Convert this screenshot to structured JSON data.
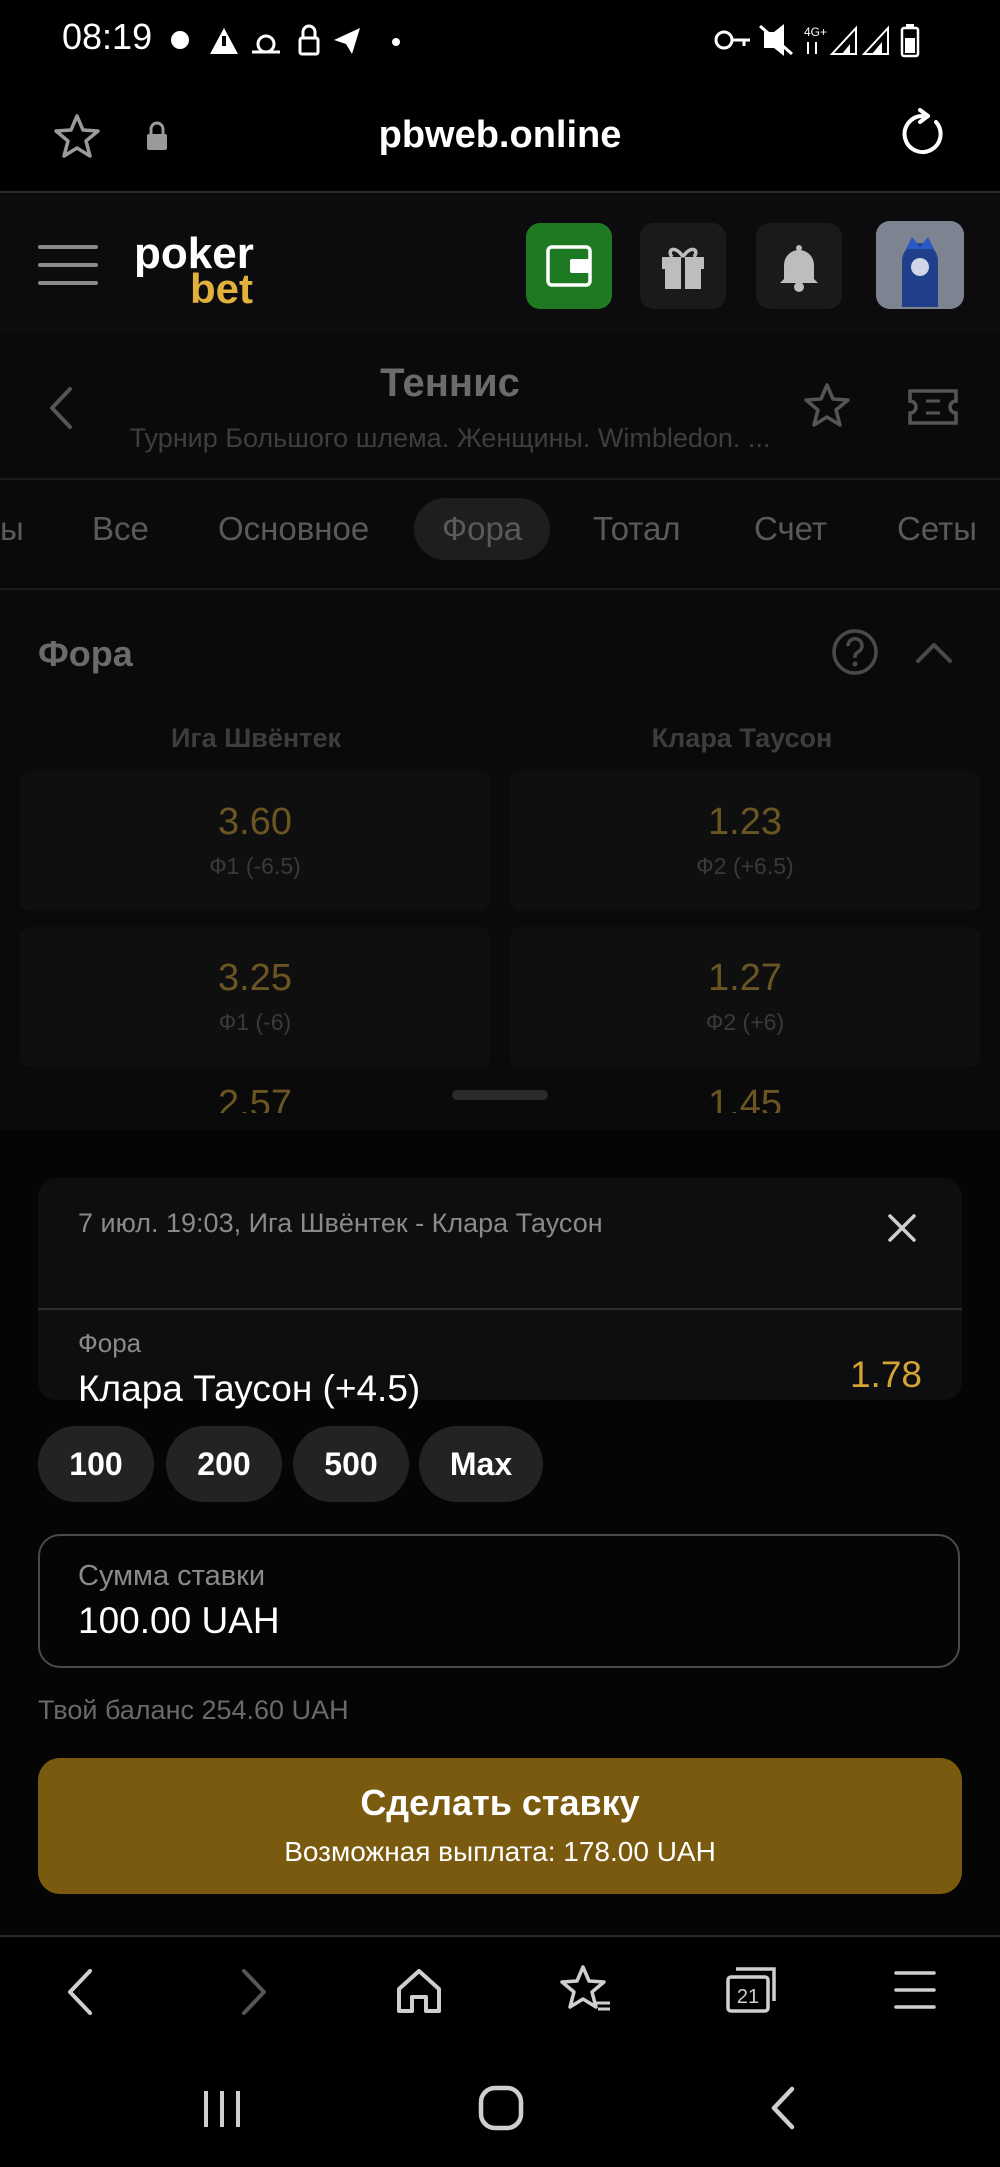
{
  "status_bar": {
    "time": "08:19",
    "network": "4G+"
  },
  "browser": {
    "url": "pbweb.online",
    "tabs_count": "21"
  },
  "header": {
    "logo_top": "poker",
    "logo_bottom": "bet"
  },
  "event": {
    "sport": "Теннис",
    "tournament": "Турнир Большого шлема. Женщины. Wimbledon. ..."
  },
  "market_tabs": [
    {
      "label": "ы"
    },
    {
      "label": "Все"
    },
    {
      "label": "Основное"
    },
    {
      "label": "Фора",
      "active": true
    },
    {
      "label": "Тотал"
    },
    {
      "label": "Счет"
    },
    {
      "label": "Сеты"
    }
  ],
  "market": {
    "title": "Фора",
    "player1": "Ига Швёнтек",
    "player2": "Клара Таусон",
    "rows": [
      {
        "odd1": "3.60",
        "label1": "Ф1 (-6.5)",
        "odd2": "1.23",
        "label2": "Ф2 (+6.5)"
      },
      {
        "odd1": "3.25",
        "label1": "Ф1 (-6)",
        "odd2": "1.27",
        "label2": "Ф2 (+6)"
      },
      {
        "odd1": "2.57",
        "label1": "",
        "odd2": "1.45",
        "label2": ""
      }
    ]
  },
  "bet_slip": {
    "event_line": "7 июл. 19:03, Ига Швёнтек - Клара Таусон",
    "market_type": "Фора",
    "selection": "Клара Таусон (+4.5)",
    "odd": "1.78",
    "quick_amounts": [
      "100",
      "200",
      "500",
      "Max"
    ],
    "amount_label": "Сумма ставки",
    "amount_value": "100.00 UAH",
    "balance_text": "Твой баланс 254.60 UAH",
    "submit_label": "Сделать ставку",
    "payout_text": "Возможная выплата: 178.00 UAH"
  },
  "colors": {
    "accent_gold": "#d5a332",
    "cta_bg": "#7a5a0e",
    "wallet_green": "#1e7a22"
  }
}
